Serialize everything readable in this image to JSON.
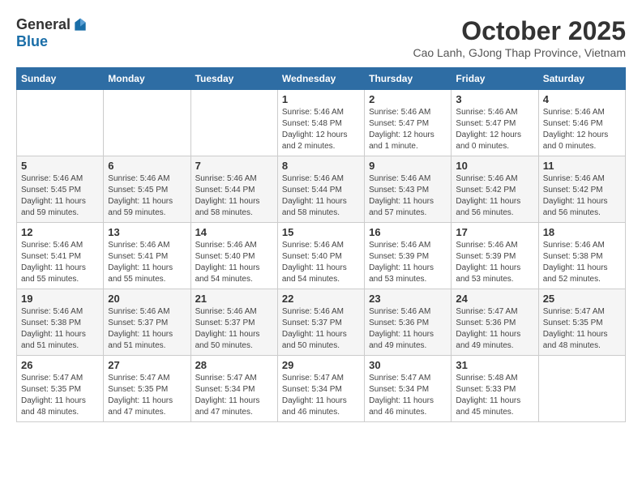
{
  "logo": {
    "general": "General",
    "blue": "Blue"
  },
  "title": {
    "month": "October 2025",
    "location": "Cao Lanh, GJong Thap Province, Vietnam"
  },
  "headers": [
    "Sunday",
    "Monday",
    "Tuesday",
    "Wednesday",
    "Thursday",
    "Friday",
    "Saturday"
  ],
  "weeks": [
    [
      {
        "day": "",
        "info": ""
      },
      {
        "day": "",
        "info": ""
      },
      {
        "day": "",
        "info": ""
      },
      {
        "day": "1",
        "info": "Sunrise: 5:46 AM\nSunset: 5:48 PM\nDaylight: 12 hours\nand 2 minutes."
      },
      {
        "day": "2",
        "info": "Sunrise: 5:46 AM\nSunset: 5:47 PM\nDaylight: 12 hours\nand 1 minute."
      },
      {
        "day": "3",
        "info": "Sunrise: 5:46 AM\nSunset: 5:47 PM\nDaylight: 12 hours\nand 0 minutes."
      },
      {
        "day": "4",
        "info": "Sunrise: 5:46 AM\nSunset: 5:46 PM\nDaylight: 12 hours\nand 0 minutes."
      }
    ],
    [
      {
        "day": "5",
        "info": "Sunrise: 5:46 AM\nSunset: 5:45 PM\nDaylight: 11 hours\nand 59 minutes."
      },
      {
        "day": "6",
        "info": "Sunrise: 5:46 AM\nSunset: 5:45 PM\nDaylight: 11 hours\nand 59 minutes."
      },
      {
        "day": "7",
        "info": "Sunrise: 5:46 AM\nSunset: 5:44 PM\nDaylight: 11 hours\nand 58 minutes."
      },
      {
        "day": "8",
        "info": "Sunrise: 5:46 AM\nSunset: 5:44 PM\nDaylight: 11 hours\nand 58 minutes."
      },
      {
        "day": "9",
        "info": "Sunrise: 5:46 AM\nSunset: 5:43 PM\nDaylight: 11 hours\nand 57 minutes."
      },
      {
        "day": "10",
        "info": "Sunrise: 5:46 AM\nSunset: 5:42 PM\nDaylight: 11 hours\nand 56 minutes."
      },
      {
        "day": "11",
        "info": "Sunrise: 5:46 AM\nSunset: 5:42 PM\nDaylight: 11 hours\nand 56 minutes."
      }
    ],
    [
      {
        "day": "12",
        "info": "Sunrise: 5:46 AM\nSunset: 5:41 PM\nDaylight: 11 hours\nand 55 minutes."
      },
      {
        "day": "13",
        "info": "Sunrise: 5:46 AM\nSunset: 5:41 PM\nDaylight: 11 hours\nand 55 minutes."
      },
      {
        "day": "14",
        "info": "Sunrise: 5:46 AM\nSunset: 5:40 PM\nDaylight: 11 hours\nand 54 minutes."
      },
      {
        "day": "15",
        "info": "Sunrise: 5:46 AM\nSunset: 5:40 PM\nDaylight: 11 hours\nand 54 minutes."
      },
      {
        "day": "16",
        "info": "Sunrise: 5:46 AM\nSunset: 5:39 PM\nDaylight: 11 hours\nand 53 minutes."
      },
      {
        "day": "17",
        "info": "Sunrise: 5:46 AM\nSunset: 5:39 PM\nDaylight: 11 hours\nand 53 minutes."
      },
      {
        "day": "18",
        "info": "Sunrise: 5:46 AM\nSunset: 5:38 PM\nDaylight: 11 hours\nand 52 minutes."
      }
    ],
    [
      {
        "day": "19",
        "info": "Sunrise: 5:46 AM\nSunset: 5:38 PM\nDaylight: 11 hours\nand 51 minutes."
      },
      {
        "day": "20",
        "info": "Sunrise: 5:46 AM\nSunset: 5:37 PM\nDaylight: 11 hours\nand 51 minutes."
      },
      {
        "day": "21",
        "info": "Sunrise: 5:46 AM\nSunset: 5:37 PM\nDaylight: 11 hours\nand 50 minutes."
      },
      {
        "day": "22",
        "info": "Sunrise: 5:46 AM\nSunset: 5:37 PM\nDaylight: 11 hours\nand 50 minutes."
      },
      {
        "day": "23",
        "info": "Sunrise: 5:46 AM\nSunset: 5:36 PM\nDaylight: 11 hours\nand 49 minutes."
      },
      {
        "day": "24",
        "info": "Sunrise: 5:47 AM\nSunset: 5:36 PM\nDaylight: 11 hours\nand 49 minutes."
      },
      {
        "day": "25",
        "info": "Sunrise: 5:47 AM\nSunset: 5:35 PM\nDaylight: 11 hours\nand 48 minutes."
      }
    ],
    [
      {
        "day": "26",
        "info": "Sunrise: 5:47 AM\nSunset: 5:35 PM\nDaylight: 11 hours\nand 48 minutes."
      },
      {
        "day": "27",
        "info": "Sunrise: 5:47 AM\nSunset: 5:35 PM\nDaylight: 11 hours\nand 47 minutes."
      },
      {
        "day": "28",
        "info": "Sunrise: 5:47 AM\nSunset: 5:34 PM\nDaylight: 11 hours\nand 47 minutes."
      },
      {
        "day": "29",
        "info": "Sunrise: 5:47 AM\nSunset: 5:34 PM\nDaylight: 11 hours\nand 46 minutes."
      },
      {
        "day": "30",
        "info": "Sunrise: 5:47 AM\nSunset: 5:34 PM\nDaylight: 11 hours\nand 46 minutes."
      },
      {
        "day": "31",
        "info": "Sunrise: 5:48 AM\nSunset: 5:33 PM\nDaylight: 11 hours\nand 45 minutes."
      },
      {
        "day": "",
        "info": ""
      }
    ]
  ]
}
